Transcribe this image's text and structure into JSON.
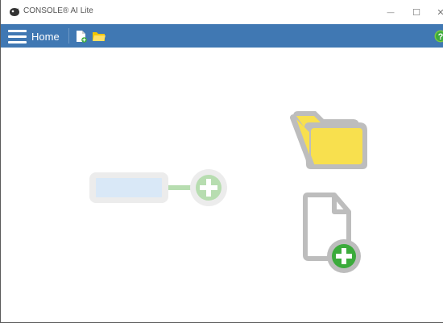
{
  "window": {
    "title": "CONSOLE® AI Lite",
    "minimize_glyph": "—",
    "maximize_glyph": "☐",
    "close_glyph": "✕"
  },
  "toolbar": {
    "menu_icon": "hamburger-menu-icon",
    "home_label": "Home",
    "new_file_icon": "new-file-icon",
    "open_folder_icon": "open-folder-icon",
    "help_icon": "help-icon",
    "help_glyph": "?"
  },
  "main": {
    "placeholder_node_icon": "add-node-placeholder-icon",
    "open_project_icon": "open-folder-large-icon",
    "new_project_icon": "new-file-large-icon"
  },
  "colors": {
    "toolbar_bg": "#4078b3",
    "folder_yellow": "#f8e04e",
    "folder_outline": "#bdbdbd",
    "add_green": "#3cab3c",
    "ghost_green": "#b7ddb0",
    "ghost_blue": "#d9e8f7"
  }
}
